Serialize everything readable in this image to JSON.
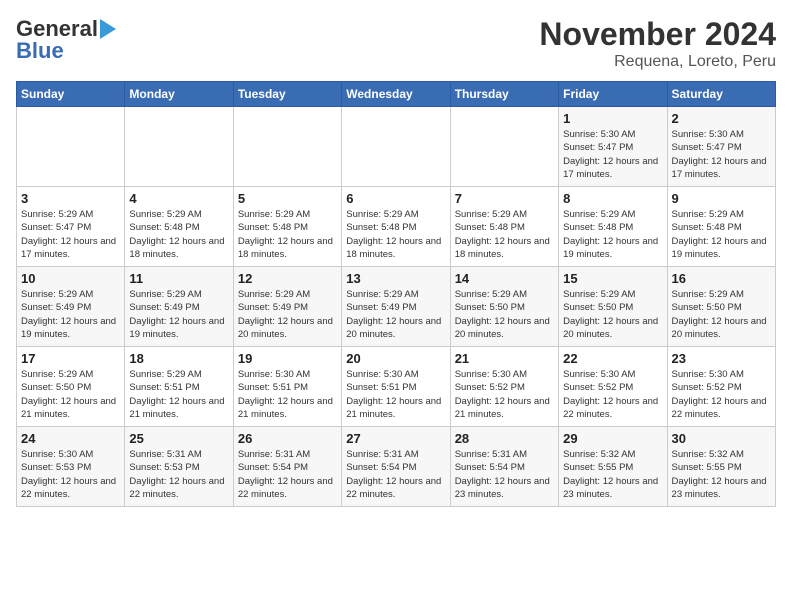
{
  "header": {
    "logo_line1": "General",
    "logo_line2": "Blue",
    "title": "November 2024",
    "subtitle": "Requena, Loreto, Peru"
  },
  "days_of_week": [
    "Sunday",
    "Monday",
    "Tuesday",
    "Wednesday",
    "Thursday",
    "Friday",
    "Saturday"
  ],
  "weeks": [
    [
      {
        "day": "",
        "info": ""
      },
      {
        "day": "",
        "info": ""
      },
      {
        "day": "",
        "info": ""
      },
      {
        "day": "",
        "info": ""
      },
      {
        "day": "",
        "info": ""
      },
      {
        "day": "1",
        "info": "Sunrise: 5:30 AM\nSunset: 5:47 PM\nDaylight: 12 hours and 17 minutes."
      },
      {
        "day": "2",
        "info": "Sunrise: 5:30 AM\nSunset: 5:47 PM\nDaylight: 12 hours and 17 minutes."
      }
    ],
    [
      {
        "day": "3",
        "info": "Sunrise: 5:29 AM\nSunset: 5:47 PM\nDaylight: 12 hours and 17 minutes."
      },
      {
        "day": "4",
        "info": "Sunrise: 5:29 AM\nSunset: 5:48 PM\nDaylight: 12 hours and 18 minutes."
      },
      {
        "day": "5",
        "info": "Sunrise: 5:29 AM\nSunset: 5:48 PM\nDaylight: 12 hours and 18 minutes."
      },
      {
        "day": "6",
        "info": "Sunrise: 5:29 AM\nSunset: 5:48 PM\nDaylight: 12 hours and 18 minutes."
      },
      {
        "day": "7",
        "info": "Sunrise: 5:29 AM\nSunset: 5:48 PM\nDaylight: 12 hours and 18 minutes."
      },
      {
        "day": "8",
        "info": "Sunrise: 5:29 AM\nSunset: 5:48 PM\nDaylight: 12 hours and 19 minutes."
      },
      {
        "day": "9",
        "info": "Sunrise: 5:29 AM\nSunset: 5:48 PM\nDaylight: 12 hours and 19 minutes."
      }
    ],
    [
      {
        "day": "10",
        "info": "Sunrise: 5:29 AM\nSunset: 5:49 PM\nDaylight: 12 hours and 19 minutes."
      },
      {
        "day": "11",
        "info": "Sunrise: 5:29 AM\nSunset: 5:49 PM\nDaylight: 12 hours and 19 minutes."
      },
      {
        "day": "12",
        "info": "Sunrise: 5:29 AM\nSunset: 5:49 PM\nDaylight: 12 hours and 20 minutes."
      },
      {
        "day": "13",
        "info": "Sunrise: 5:29 AM\nSunset: 5:49 PM\nDaylight: 12 hours and 20 minutes."
      },
      {
        "day": "14",
        "info": "Sunrise: 5:29 AM\nSunset: 5:50 PM\nDaylight: 12 hours and 20 minutes."
      },
      {
        "day": "15",
        "info": "Sunrise: 5:29 AM\nSunset: 5:50 PM\nDaylight: 12 hours and 20 minutes."
      },
      {
        "day": "16",
        "info": "Sunrise: 5:29 AM\nSunset: 5:50 PM\nDaylight: 12 hours and 20 minutes."
      }
    ],
    [
      {
        "day": "17",
        "info": "Sunrise: 5:29 AM\nSunset: 5:50 PM\nDaylight: 12 hours and 21 minutes."
      },
      {
        "day": "18",
        "info": "Sunrise: 5:29 AM\nSunset: 5:51 PM\nDaylight: 12 hours and 21 minutes."
      },
      {
        "day": "19",
        "info": "Sunrise: 5:30 AM\nSunset: 5:51 PM\nDaylight: 12 hours and 21 minutes."
      },
      {
        "day": "20",
        "info": "Sunrise: 5:30 AM\nSunset: 5:51 PM\nDaylight: 12 hours and 21 minutes."
      },
      {
        "day": "21",
        "info": "Sunrise: 5:30 AM\nSunset: 5:52 PM\nDaylight: 12 hours and 21 minutes."
      },
      {
        "day": "22",
        "info": "Sunrise: 5:30 AM\nSunset: 5:52 PM\nDaylight: 12 hours and 22 minutes."
      },
      {
        "day": "23",
        "info": "Sunrise: 5:30 AM\nSunset: 5:52 PM\nDaylight: 12 hours and 22 minutes."
      }
    ],
    [
      {
        "day": "24",
        "info": "Sunrise: 5:30 AM\nSunset: 5:53 PM\nDaylight: 12 hours and 22 minutes."
      },
      {
        "day": "25",
        "info": "Sunrise: 5:31 AM\nSunset: 5:53 PM\nDaylight: 12 hours and 22 minutes."
      },
      {
        "day": "26",
        "info": "Sunrise: 5:31 AM\nSunset: 5:54 PM\nDaylight: 12 hours and 22 minutes."
      },
      {
        "day": "27",
        "info": "Sunrise: 5:31 AM\nSunset: 5:54 PM\nDaylight: 12 hours and 22 minutes."
      },
      {
        "day": "28",
        "info": "Sunrise: 5:31 AM\nSunset: 5:54 PM\nDaylight: 12 hours and 23 minutes."
      },
      {
        "day": "29",
        "info": "Sunrise: 5:32 AM\nSunset: 5:55 PM\nDaylight: 12 hours and 23 minutes."
      },
      {
        "day": "30",
        "info": "Sunrise: 5:32 AM\nSunset: 5:55 PM\nDaylight: 12 hours and 23 minutes."
      }
    ]
  ]
}
